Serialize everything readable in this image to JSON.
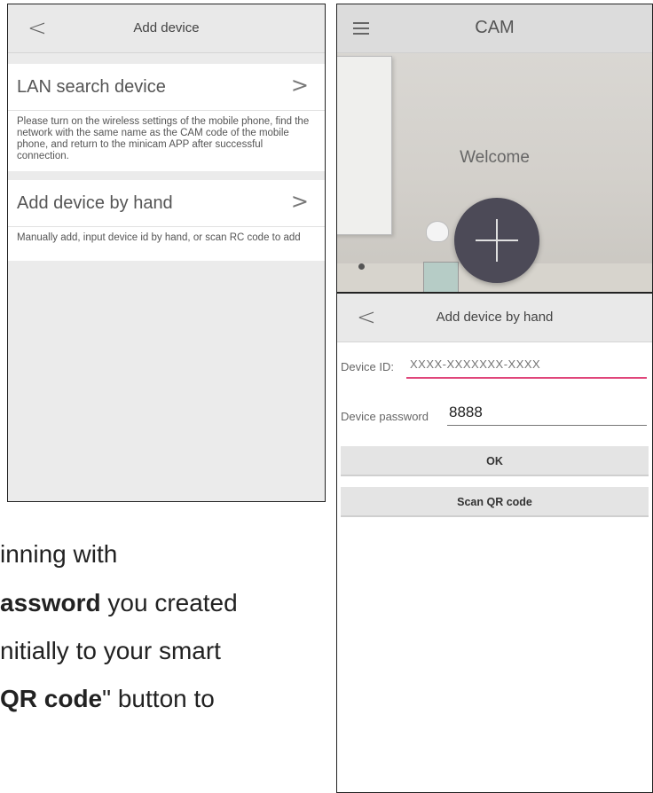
{
  "left_screen": {
    "title": "Add device",
    "back_icon": "<",
    "items": [
      {
        "label": "LAN search device",
        "chevron": ">",
        "description": "Please turn on the wireless settings of the mobile phone, find the network with the same name as the CAM code of the mobile phone, and return to the minicam APP after successful connection."
      },
      {
        "label": "Add device by hand",
        "chevron": ">",
        "description": "Manually add, input device id by hand, or scan RC code to add"
      }
    ]
  },
  "cam_screen": {
    "title": "CAM",
    "menu_icon": "hamburger-menu-icon",
    "welcome": "Welcome",
    "add_button_icon": "plus-icon",
    "fab_color": "#4c4a57"
  },
  "hand_screen": {
    "back_icon": "<",
    "title": "Add device by hand",
    "device_id_label": "Device ID:",
    "device_id_placeholder": "XXXX-XXXXXXX-XXXX",
    "device_password_label": "Device password",
    "device_password_value": "8888",
    "ok_button": "OK",
    "scan_button": "Scan QR code",
    "accent_color": "#e0467a"
  },
  "instructions": {
    "line1": "inning with",
    "line2_bold": "assword",
    "line2_rest": " you created",
    "line3": "nitially to your smart",
    "line4_bold": "QR code",
    "line4_rest": "\" button to"
  }
}
